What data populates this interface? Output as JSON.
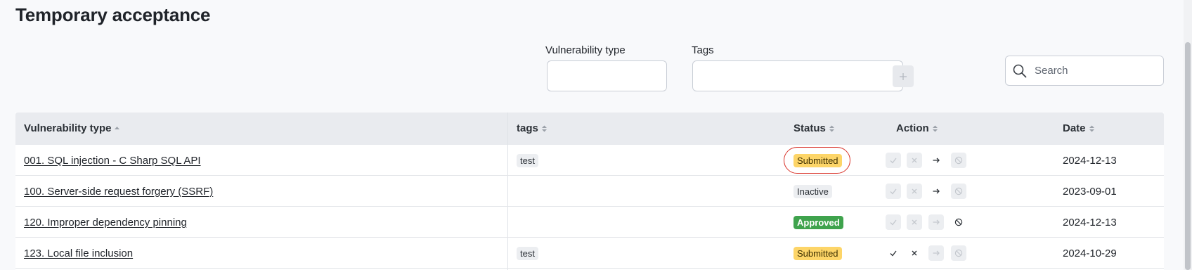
{
  "page": {
    "title": "Temporary acceptance"
  },
  "filters": {
    "vulnerability_type_label": "Vulnerability type",
    "vulnerability_type_value": "",
    "tags_label": "Tags",
    "tags_value": "",
    "add_button_icon": "plus-icon",
    "search_placeholder": "Search"
  },
  "table": {
    "columns": [
      {
        "label": "Vulnerability type",
        "sort": "ascending"
      },
      {
        "label": "tags",
        "sort": "none"
      },
      {
        "label": "Status",
        "sort": "none"
      },
      {
        "label": "Action",
        "sort": "none"
      },
      {
        "label": "Date",
        "sort": "none"
      }
    ],
    "rows": [
      {
        "vulnerability": "001. SQL injection - C Sharp SQL API",
        "tag": "test",
        "status": "Submitted",
        "highlighted": true,
        "actions": {
          "approve_enabled": false,
          "reject_enabled": false,
          "forward_enabled": true,
          "revoke_enabled": false
        },
        "date": "2024-12-13"
      },
      {
        "vulnerability": "100. Server-side request forgery (SSRF)",
        "tag": "",
        "status": "Inactive",
        "highlighted": false,
        "actions": {
          "approve_enabled": false,
          "reject_enabled": false,
          "forward_enabled": true,
          "revoke_enabled": false
        },
        "date": "2023-09-01"
      },
      {
        "vulnerability": "120. Improper dependency pinning",
        "tag": "",
        "status": "Approved",
        "highlighted": false,
        "actions": {
          "approve_enabled": false,
          "reject_enabled": false,
          "forward_enabled": false,
          "revoke_enabled": true
        },
        "date": "2024-12-13"
      },
      {
        "vulnerability": "123. Local file inclusion",
        "tag": "test",
        "status": "Submitted",
        "highlighted": false,
        "actions": {
          "approve_enabled": true,
          "reject_enabled": true,
          "forward_enabled": false,
          "revoke_enabled": false
        },
        "date": "2024-10-29"
      }
    ]
  },
  "colors": {
    "submitted": "#fdd568",
    "inactive": "#eceef1",
    "approved": "#3fa34d",
    "highlight_ring": "#d9342b"
  }
}
